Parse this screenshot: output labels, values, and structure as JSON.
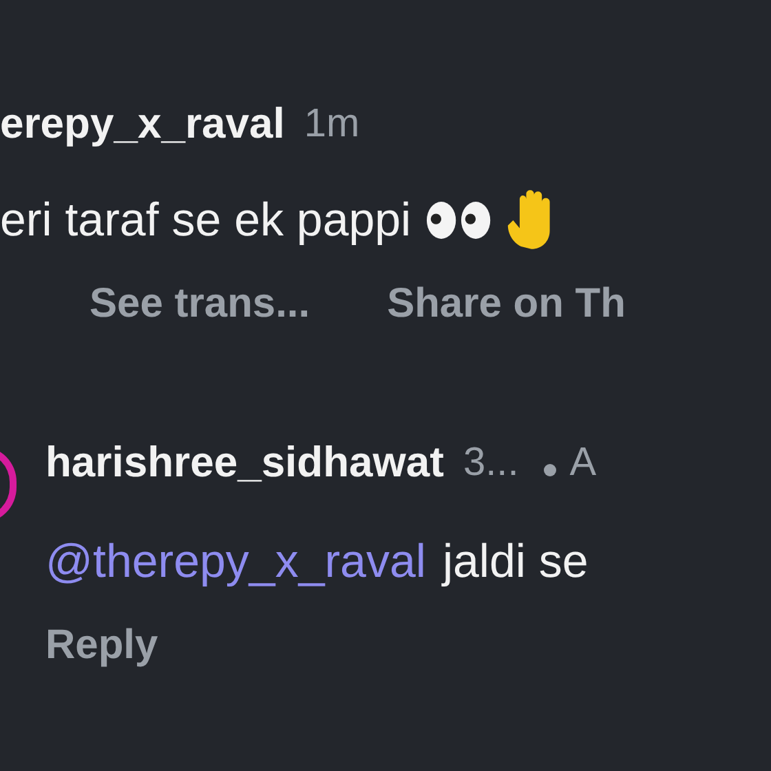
{
  "comments": [
    {
      "username": "erepy_x_raval",
      "time": "1m",
      "text": "eri taraf se ek pappi",
      "actions": [
        "See trans...",
        "Share on Th"
      ]
    },
    {
      "username": "harishree_sidhawat",
      "time": "3...",
      "extra": "A",
      "mention": "@therepy_x_raval",
      "text": "jaldi se",
      "actions": [
        "Reply"
      ]
    }
  ]
}
